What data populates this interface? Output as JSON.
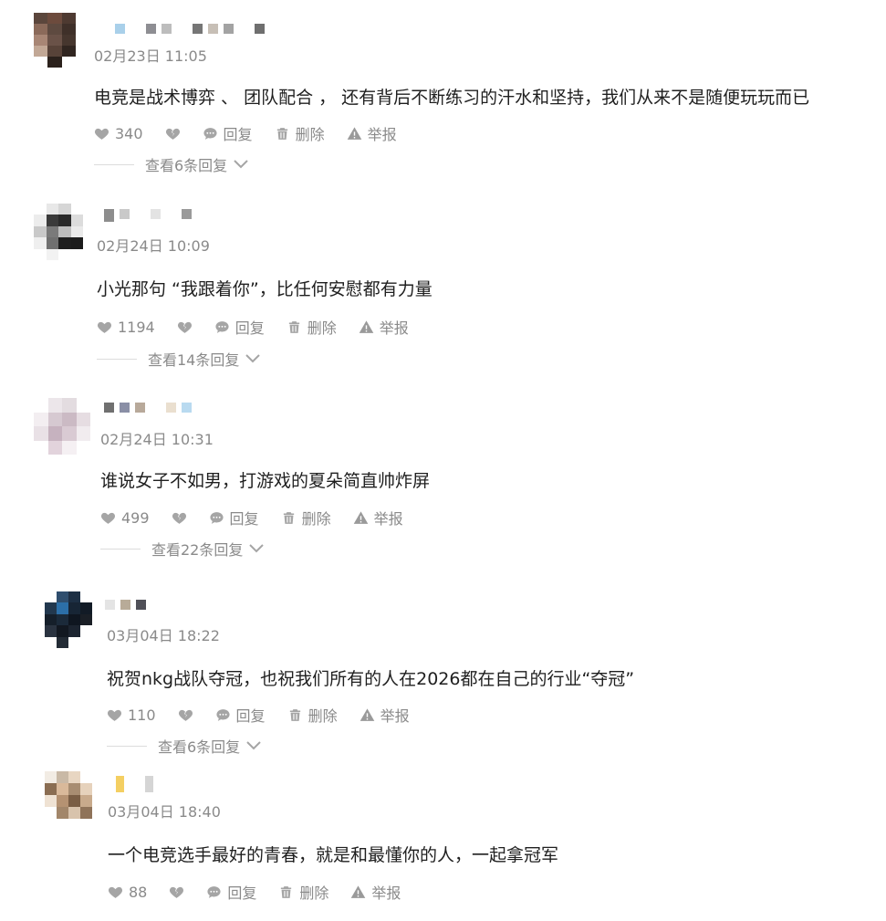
{
  "comments": [
    {
      "time": "02月23日 11:05",
      "text": "电竞是战术博弈 、 团队配合 ， 还有背后不断练习的汗水和坚持，我们从来不是随便玩玩而已",
      "likes": "340",
      "reply_label": "回复",
      "delete_label": "删除",
      "report_label": "举报",
      "view_replies": "查看6条回复"
    },
    {
      "time": "02月24日 10:09",
      "text": "小光那句 “我跟着你”，比任何安慰都有力量",
      "likes": "1194",
      "reply_label": "回复",
      "delete_label": "删除",
      "report_label": "举报",
      "view_replies": "查看14条回复"
    },
    {
      "time": "02月24日 10:31",
      "text": "谁说女子不如男，打游戏的夏朵简直帅炸屏",
      "likes": "499",
      "reply_label": "回复",
      "delete_label": "删除",
      "report_label": "举报",
      "view_replies": "查看22条回复"
    },
    {
      "time": "03月04日 18:22",
      "text": "祝贺nkg战队夺冠，也祝我们所有的人在2026都在自己的行业“夺冠”",
      "likes": "110",
      "reply_label": "回复",
      "delete_label": "删除",
      "report_label": "举报",
      "view_replies": "查看6条回复"
    },
    {
      "time": "03月04日 18:40",
      "text": "一个电竞选手最好的青春，就是和最懂你的人，一起拿冠军",
      "likes": "88",
      "reply_label": "回复",
      "delete_label": "删除",
      "report_label": "举报"
    }
  ],
  "icons": {
    "like": "heart-icon",
    "dislike": "broken-heart-icon",
    "reply": "speech-bubble-icon",
    "delete": "trash-icon",
    "report": "warning-triangle-icon",
    "expand": "chevron-down-icon"
  },
  "colors": {
    "text": "#1f1f1f",
    "meta": "#8a8a8a",
    "icon": "#a5a5a5"
  }
}
